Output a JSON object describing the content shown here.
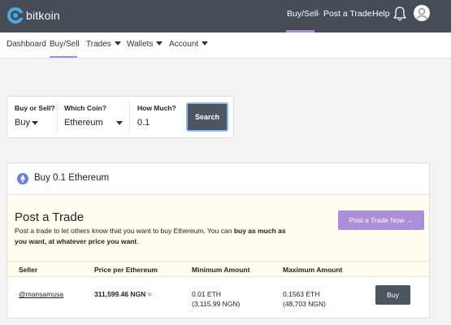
{
  "brand": {
    "name": "bitkoin",
    "accent": "#a98bd8",
    "topbar_color": "#474d57"
  },
  "topnav": {
    "buy_sell": "Buy/Sell",
    "sep": "·",
    "post_trade": "Post a Trade",
    "help": "Help",
    "bell_icon": "bell-icon",
    "avatar_icon": "user-avatar-icon"
  },
  "subnav": {
    "dashboard": "Dashboard",
    "buy_sell": "Buy/Sell",
    "trades": "Trades",
    "wallets": "Wallets",
    "account": "Account"
  },
  "search": {
    "buy_or_sell_label": "Buy or Sell?",
    "buy_or_sell_value": "Buy",
    "coin_label": "Which Coin?",
    "coin_value": "Ethereum",
    "amount_label": "How Much?",
    "amount_value": "0.1",
    "search_button": "Search"
  },
  "card": {
    "title": "Buy 0.1 Ethereum",
    "post": {
      "title": "Post a Trade",
      "desc_part1": "Post a trade to let others know that you want to buy Ethereum. You can ",
      "desc_bold": "buy as much as you want, at whatever price you want",
      "desc_part2": ".",
      "button": "Post a Trade Now →"
    },
    "table": {
      "headers": [
        "Seller",
        "Price per Ethereum",
        "Minimum Amount",
        "Maximum Amount"
      ],
      "rows": [
        {
          "seller": "@mansamusa",
          "price": "311,599.46 NGN",
          "approx": "≈",
          "min": "0.01 ETH",
          "min_ngn": "(3,115.99 NGN)",
          "max": "0.1563 ETH",
          "max_ngn": "(48,703 NGN)",
          "button": "Buy"
        }
      ]
    }
  }
}
